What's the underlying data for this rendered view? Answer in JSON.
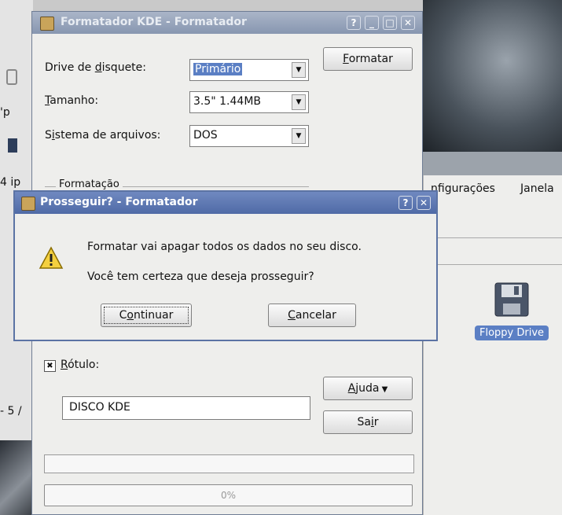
{
  "background": {
    "left_fragments": [
      "'p",
      "4 ip",
      "- 5 /"
    ],
    "menu_items": [
      "nfigurações",
      "Janela"
    ],
    "floppy_label": "Floppy Drive"
  },
  "formatter_window": {
    "title": "Formatador KDE - Formatador",
    "title_buttons": [
      "?",
      "_",
      "□",
      "✕"
    ],
    "drive_label_pre": "Drive de ",
    "drive_label_mn": "d",
    "drive_label_post": "isquete:",
    "drive_value": "Primário",
    "size_label_mn": "T",
    "size_label_post": "amanho:",
    "size_value": "3.5\" 1.44MB",
    "fs_label_pre": "S",
    "fs_label_mn": "i",
    "fs_label_post": "stema de arquivos:",
    "fs_value": "DOS",
    "format_button_mn": "F",
    "format_button_post": "ormatar",
    "group_label": "Formatação",
    "checkbox_mark": "✖",
    "label_checkbox_mn": "R",
    "label_checkbox_post": "ótulo:",
    "label_value": "DISCO KDE",
    "help_button_mn": "A",
    "help_button_post": "juda",
    "exit_button_pre": "Sa",
    "exit_button_mn": "i",
    "exit_button_post": "r",
    "progress_percent": 0,
    "progress_text": "0%"
  },
  "dialog": {
    "title": "Prosseguir? - Formatador",
    "title_buttons": [
      "?",
      "✕"
    ],
    "message_line1": "Formatar vai apagar todos os dados no seu disco.",
    "message_line2": "Você tem certeza que deseja prosseguir?",
    "continue_pre": "C",
    "continue_mn": "o",
    "continue_post": "ntinuar",
    "cancel_mn": "C",
    "cancel_post": "ancelar"
  }
}
